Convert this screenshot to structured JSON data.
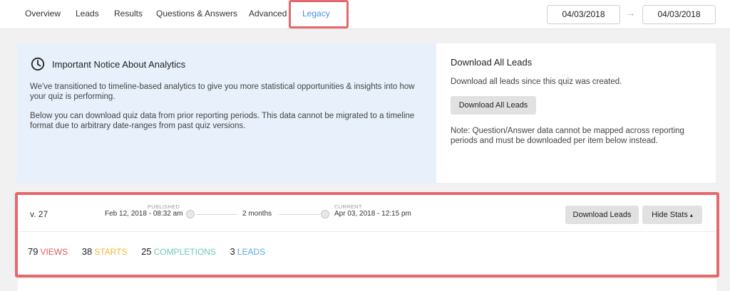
{
  "nav": {
    "tabs": [
      "Overview",
      "Leads",
      "Results",
      "Questions & Answers",
      "Advanced",
      "Legacy"
    ],
    "active_tab": "Legacy",
    "date_start": "04/03/2018",
    "date_end": "04/03/2018",
    "arrow": "→"
  },
  "notice": {
    "title": "Important Notice About Analytics",
    "para1": "We've transitioned to timeline-based analytics to give you more statistical opportunities & insights into how your quiz is performing.",
    "para2": "Below you can download quiz data from prior reporting periods. This data cannot be migrated to a timeline format due to arbitrary date-ranges from past quiz versions."
  },
  "download_all": {
    "title": "Download All Leads",
    "subtitle": "Download all leads since this quiz was created.",
    "button": "Download All Leads",
    "note": "Note: Question/Answer data cannot be mapped across reporting periods and must be downloaded per item below instead."
  },
  "version": {
    "label": "v. 27",
    "published_label": "PUBLISHED",
    "published_date": "Feb 12, 2018 - 08:32 am",
    "duration": "2 months",
    "current_label": "CURRENT",
    "current_date": "Apr 03, 2018 - 12:15 pm",
    "download_button": "Download Leads",
    "hide_stats_button": "Hide Stats",
    "caret": "▴",
    "stats": [
      {
        "value": "79",
        "label": "VIEWS",
        "color": "#e0585c"
      },
      {
        "value": "38",
        "label": "STARTS",
        "color": "#f2b632"
      },
      {
        "value": "25",
        "label": "COMPLETIONS",
        "color": "#6fc7b8"
      },
      {
        "value": "3",
        "label": "LEADS",
        "color": "#58a9dd"
      }
    ]
  },
  "colors": {
    "highlight": "#e4686d",
    "active_tab": "#4a90e2",
    "notice_bg": "#e7f0fb"
  }
}
